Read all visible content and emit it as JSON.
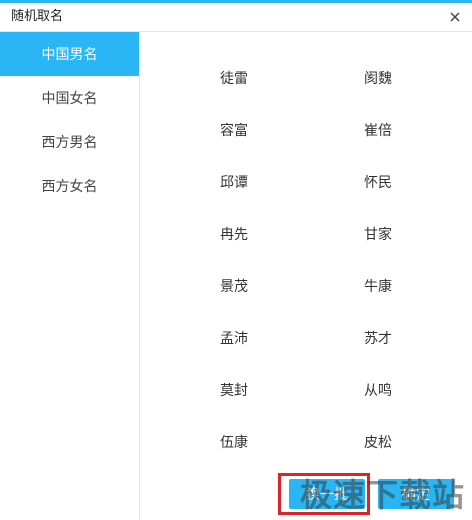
{
  "window": {
    "title": "随机取名",
    "accent_color": "#2ab5f4",
    "close_icon": "close-icon"
  },
  "sidebar": {
    "items": [
      {
        "label": "中国男名",
        "active": true
      },
      {
        "label": "中国女名",
        "active": false
      },
      {
        "label": "西方男名",
        "active": false
      },
      {
        "label": "西方女名",
        "active": false
      }
    ]
  },
  "names": {
    "left": [
      "徒雷",
      "容富",
      "邱谭",
      "冉先",
      "景茂",
      "孟沛",
      "莫封",
      "伍康"
    ],
    "right": [
      "阂魏",
      "崔倍",
      "怀民",
      "甘家",
      "牛康",
      "苏才",
      "从鸣",
      "皮松"
    ]
  },
  "buttons": {
    "random_label": "换一批",
    "confirm_label": "确定"
  },
  "watermark": "极速下载站"
}
